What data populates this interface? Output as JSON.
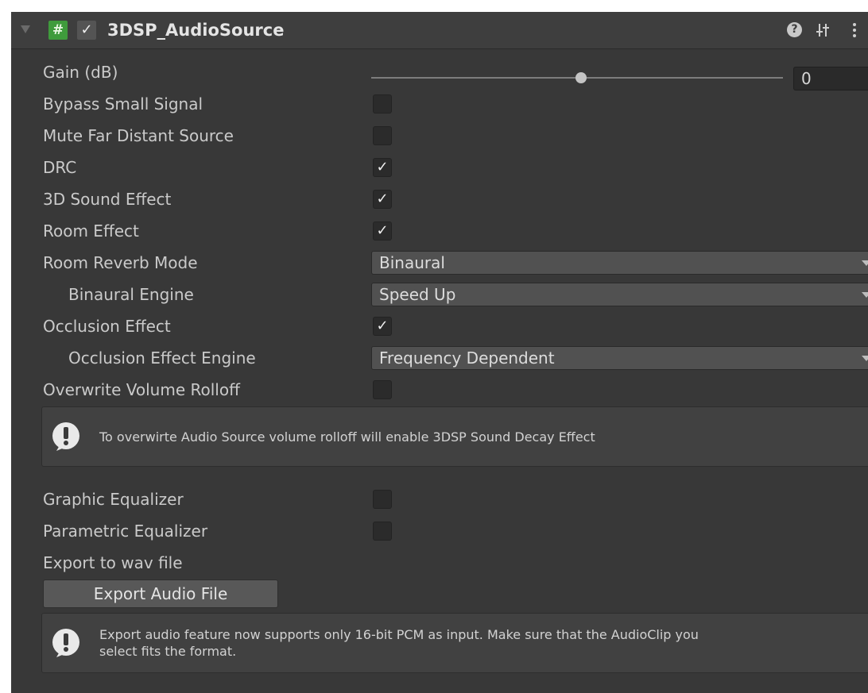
{
  "component": {
    "title": "3DSP_AudioSource",
    "enabled_checkmark": "✓",
    "script_icon": "#",
    "header_icons": [
      "help-icon",
      "presets-icon",
      "more-menu-icon"
    ]
  },
  "gain": {
    "label": "Gain (dB)",
    "value": "0",
    "slider_fraction": 0.51
  },
  "fields": {
    "bypass_small_signal": {
      "label": "Bypass Small Signal",
      "checked": false
    },
    "mute_far_distant_source": {
      "label": "Mute Far Distant Source",
      "checked": false
    },
    "drc": {
      "label": "DRC",
      "checked": true,
      "mark": "✓"
    },
    "sound_3d_effect": {
      "label": "3D Sound Effect",
      "checked": true,
      "mark": "✓"
    },
    "room_effect": {
      "label": "Room Effect",
      "checked": true,
      "mark": "✓"
    },
    "room_reverb_mode": {
      "label": "Room Reverb Mode",
      "value": "Binaural"
    },
    "binaural_engine": {
      "label": "Binaural Engine",
      "value": "Speed Up"
    },
    "occlusion_effect": {
      "label": "Occlusion Effect",
      "checked": true,
      "mark": "✓"
    },
    "occlusion_effect_engine": {
      "label": "Occlusion Effect Engine",
      "value": "Frequency Dependent"
    },
    "overwrite_volume_rolloff": {
      "label": "Overwrite Volume Rolloff",
      "checked": false
    },
    "graphic_equalizer": {
      "label": "Graphic Equalizer",
      "checked": false
    },
    "parametric_equalizer": {
      "label": "Parametric Equalizer",
      "checked": false
    },
    "export_to_wav": {
      "label": "Export to wav file"
    }
  },
  "rolloff_help": {
    "text": "To overwirte Audio Source volume rolloff will enable 3DSP Sound Decay Effect"
  },
  "export_button": {
    "label": "Export Audio File"
  },
  "export_help": {
    "line1": "Export audio feature now supports only 16-bit PCM as input. Make sure that the AudioClip you",
    "line2": "select fits the format."
  },
  "colors": {
    "panel_bg": "#383838",
    "header_bg": "#3e3e3e",
    "script_icon_green": "#3f9b3c",
    "text": "#cacaca"
  }
}
